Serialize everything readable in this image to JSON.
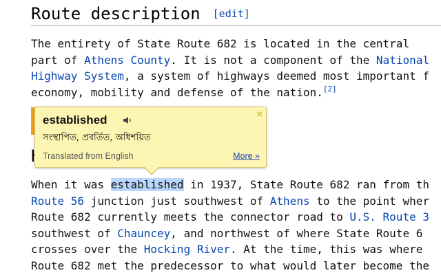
{
  "heading": {
    "title": "Route description",
    "edit": "[edit]"
  },
  "para1": {
    "l1": "The entirety of State Route 682 is located in the central",
    "l2_a": "part of ",
    "l2_link": "Athens County",
    "l2_b": ". It is not a component of the ",
    "l2_link2": "National",
    "l3_link": "Highway System",
    "l3_b": ", a system of highways deemed most important f",
    "l4": "economy, mobility and defense of the nation.",
    "ref": "[2]"
  },
  "peek": "H",
  "popup": {
    "word": "established",
    "translation": "সংস্থাপিত, প্রবর্তিত, অধিশয়িত",
    "from": "Translated from English",
    "more": "More »",
    "close": "×",
    "icons": {
      "speaker": "speaker-icon",
      "close": "close-icon"
    },
    "bg_color": "#fdf6b3"
  },
  "para2": {
    "l1_a": "When it was ",
    "l1_hl": "established",
    "l1_b": " in 1937, State Route 682 ran from th",
    "l2_link": "Route 56",
    "l2_a": " junction just southwest of ",
    "l2_link2": "Athens",
    "l2_b": " to the point wher",
    "l3_a": "Route 682 currently meets the connector road to ",
    "l3_link": "U.S. Route 3",
    "l4_a": "southwest of ",
    "l4_link": "Chauncey",
    "l4_b": ", and northwest of where State Route 6",
    "l5_a": "crosses over the ",
    "l5_link": "Hocking River",
    "l5_b": ". At the time, this was where",
    "l6": "Route 682 met the predecessor to what would later become the"
  },
  "colors": {
    "link": "#0645ad",
    "highlight": "#b8d7fb",
    "accent": "#f29d1f"
  }
}
